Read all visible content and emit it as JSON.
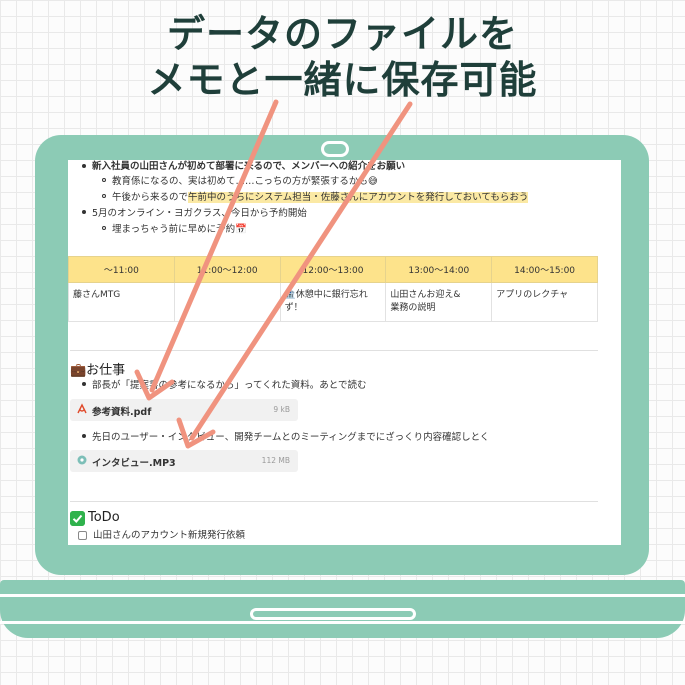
{
  "headline": {
    "line1": "データのファイルを",
    "line2": "メモと一緒に保存可能"
  },
  "notes": {
    "partial_top": "新入社員の山田さんが初めて部署に来るので、メンバーへの紹介をお願い",
    "sub1": "教育係になるの、実は初めて……こっちの方が緊張するかも😅",
    "sub2_plain": "午後から来るので",
    "sub2_highlight": "午前中のうちにシステム担当・佐藤さんにアカウントを発行しておいてもらおう",
    "item2": "5月のオンライン・ヨガクラス、今日から予約開始",
    "item2_sub": "埋まっちゃう前に早めに予約📅"
  },
  "schedule": {
    "headers": [
      "〜11:00",
      "11:00〜12:00",
      "12:00〜13:00",
      "13:00〜14:00",
      "14:00〜15:00"
    ],
    "cells": [
      [
        "藤さんMTG"
      ],
      [
        ""
      ],
      [
        "🏦休憩中に銀行忘れ",
        "ず！"
      ],
      [
        "山田さんお迎え&",
        "業務の説明"
      ],
      [
        "アプリのレクチャ"
      ]
    ]
  },
  "work_section": {
    "title": "💼お仕事",
    "item1": "部長が「提案書の参考になるから」ってくれた資料。あとで読む",
    "file1": {
      "name": "参考資料.pdf",
      "size": "9 kB",
      "icon": "pdf-icon"
    },
    "item2": "先日のユーザー・インタビュー、開発チームとのミーティングまでにざっくり内容確認しとく",
    "file2": {
      "name": "インタビュー.MP3",
      "size": "112 MB",
      "icon": "audio-icon"
    }
  },
  "todo_section": {
    "title": "ToDo",
    "icon": "checkmark-icon",
    "item1": "山田さんのアカウント新規発行依頼"
  },
  "colors": {
    "laptop": "#8ccbb5",
    "headline": "#1f3f3a",
    "arrow": "#f0937f",
    "table_header": "#fde38b",
    "highlight": "#fbe9a4"
  }
}
